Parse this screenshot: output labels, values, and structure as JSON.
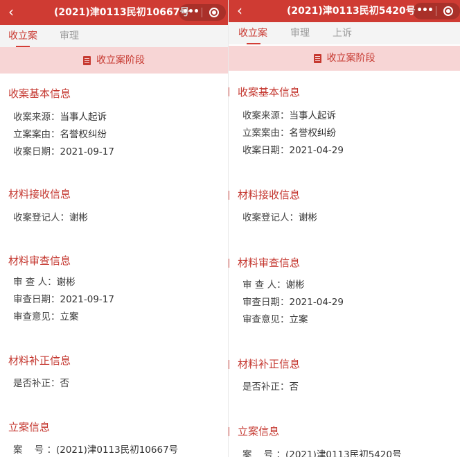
{
  "left": {
    "title": "(2021)津0113民初10667号",
    "back_icon": "chevron-left-icon",
    "capsule": {
      "more": "•••",
      "more_icon": "more-dots-icon",
      "close_icon": "target-close-icon"
    },
    "tabs": [
      {
        "label": "收立案",
        "active": true
      },
      {
        "label": "审理",
        "active": false
      }
    ],
    "banner": {
      "icon": "document-icon",
      "label": "收立案阶段"
    },
    "sections": [
      {
        "title": "收案基本信息",
        "rows": [
          {
            "key": "收案来源：",
            "value": "当事人起诉"
          },
          {
            "key": "立案案由：",
            "value": "名誉权纠纷"
          },
          {
            "key": "收案日期：",
            "value": "2021-09-17"
          }
        ]
      },
      {
        "title": "材料接收信息",
        "rows": [
          {
            "key": "收案登记人：",
            "value": "谢彬"
          }
        ]
      },
      {
        "title": "材料审查信息",
        "rows": [
          {
            "key": "审 查 人：",
            "value": "谢彬"
          },
          {
            "key": "审查日期：",
            "value": "2021-09-17"
          },
          {
            "key": "审查意见：",
            "value": "立案"
          }
        ]
      },
      {
        "title": "材料补正信息",
        "rows": [
          {
            "key": "是否补正：",
            "value": "否"
          }
        ]
      },
      {
        "title": "立案信息",
        "rows": [
          {
            "key": "案    号 ：",
            "value": "(2021)津0113民初10667号"
          }
        ]
      }
    ]
  },
  "right": {
    "title": "(2021)津0113民初5420号",
    "back_icon": "chevron-left-icon",
    "capsule": {
      "more": "•••",
      "more_icon": "more-dots-icon",
      "close_icon": "target-close-icon"
    },
    "tabs": [
      {
        "label": "收立案",
        "active": true
      },
      {
        "label": "审理",
        "active": false
      },
      {
        "label": "上诉",
        "active": false
      }
    ],
    "banner": {
      "icon": "document-icon",
      "label": "收立案阶段"
    },
    "sections": [
      {
        "title": "收案基本信息",
        "rows": [
          {
            "key": "收案来源：",
            "value": "当事人起诉"
          },
          {
            "key": "立案案由：",
            "value": "名誉权纠纷"
          },
          {
            "key": "收案日期：",
            "value": "2021-04-29"
          }
        ]
      },
      {
        "title": "材料接收信息",
        "rows": [
          {
            "key": "收案登记人：",
            "value": "谢彬"
          }
        ]
      },
      {
        "title": "材料审查信息",
        "rows": [
          {
            "key": "审 查 人：",
            "value": "谢彬"
          },
          {
            "key": "审查日期：",
            "value": "2021-04-29"
          },
          {
            "key": "审查意见：",
            "value": "立案"
          }
        ]
      },
      {
        "title": "材料补正信息",
        "rows": [
          {
            "key": "是否补正：",
            "value": "否"
          }
        ]
      },
      {
        "title": "立案信息",
        "rows": [
          {
            "key": "案    号 ：",
            "value": "(2021)津0113民初5420号"
          }
        ]
      }
    ]
  }
}
